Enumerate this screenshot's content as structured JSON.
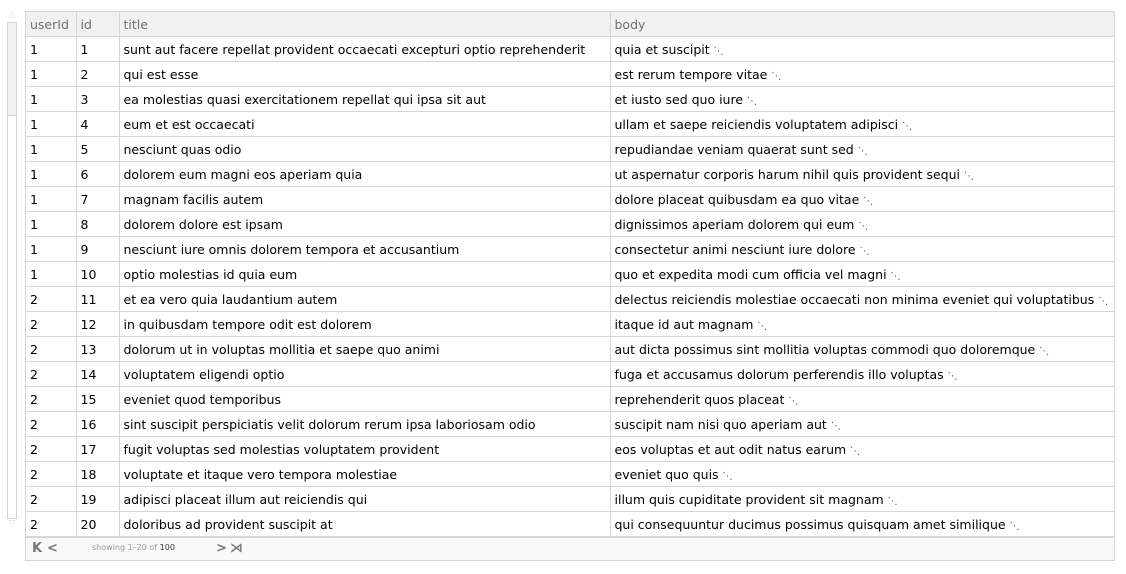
{
  "scrollbar": {
    "up_icon": "△",
    "down_icon": "▽"
  },
  "columns": [
    "userId",
    "id",
    "title",
    "body"
  ],
  "ellipsis": "⋱",
  "rows": [
    {
      "userId": "1",
      "id": "1",
      "title": "sunt aut facere repellat provident occaecati excepturi optio reprehenderit",
      "body": "quia et suscipit"
    },
    {
      "userId": "1",
      "id": "2",
      "title": "qui est esse",
      "body": "est rerum tempore vitae"
    },
    {
      "userId": "1",
      "id": "3",
      "title": "ea molestias quasi exercitationem repellat qui ipsa sit aut",
      "body": "et iusto sed quo iure"
    },
    {
      "userId": "1",
      "id": "4",
      "title": "eum et est occaecati",
      "body": "ullam et saepe reiciendis voluptatem adipisci"
    },
    {
      "userId": "1",
      "id": "5",
      "title": "nesciunt quas odio",
      "body": "repudiandae veniam quaerat sunt sed"
    },
    {
      "userId": "1",
      "id": "6",
      "title": "dolorem eum magni eos aperiam quia",
      "body": "ut aspernatur corporis harum nihil quis provident sequi"
    },
    {
      "userId": "1",
      "id": "7",
      "title": "magnam facilis autem",
      "body": "dolore placeat quibusdam ea quo vitae"
    },
    {
      "userId": "1",
      "id": "8",
      "title": "dolorem dolore est ipsam",
      "body": "dignissimos aperiam dolorem qui eum"
    },
    {
      "userId": "1",
      "id": "9",
      "title": "nesciunt iure omnis dolorem tempora et accusantium",
      "body": "consectetur animi nesciunt iure dolore"
    },
    {
      "userId": "1",
      "id": "10",
      "title": "optio molestias id quia eum",
      "body": "quo et expedita modi cum officia vel magni"
    },
    {
      "userId": "2",
      "id": "11",
      "title": "et ea vero quia laudantium autem",
      "body": "delectus reiciendis molestiae occaecati non minima eveniet qui voluptatibus"
    },
    {
      "userId": "2",
      "id": "12",
      "title": "in quibusdam tempore odit est dolorem",
      "body": "itaque id aut magnam"
    },
    {
      "userId": "2",
      "id": "13",
      "title": "dolorum ut in voluptas mollitia et saepe quo animi",
      "body": "aut dicta possimus sint mollitia voluptas commodi quo doloremque"
    },
    {
      "userId": "2",
      "id": "14",
      "title": "voluptatem eligendi optio",
      "body": "fuga et accusamus dolorum perferendis illo voluptas"
    },
    {
      "userId": "2",
      "id": "15",
      "title": "eveniet quod temporibus",
      "body": "reprehenderit quos placeat"
    },
    {
      "userId": "2",
      "id": "16",
      "title": "sint suscipit perspiciatis velit dolorum rerum ipsa laboriosam odio",
      "body": "suscipit nam nisi quo aperiam aut"
    },
    {
      "userId": "2",
      "id": "17",
      "title": "fugit voluptas sed molestias voluptatem provident",
      "body": "eos voluptas et aut odit natus earum"
    },
    {
      "userId": "2",
      "id": "18",
      "title": "voluptate et itaque vero tempora molestiae",
      "body": "eveniet quo quis"
    },
    {
      "userId": "2",
      "id": "19",
      "title": "adipisci placeat illum aut reiciendis qui",
      "body": "illum quis cupiditate provident sit magnam"
    },
    {
      "userId": "2",
      "id": "20",
      "title": "doloribus ad provident suscipit at",
      "body": "qui consequuntur ducimus possimus quisquam amet similique"
    }
  ],
  "pagination": {
    "first_icon": "K",
    "prev_icon": "<",
    "next_icon": ">",
    "last_icon": "⋊",
    "status_prefix": "showing 1–20 of",
    "total": "100"
  }
}
